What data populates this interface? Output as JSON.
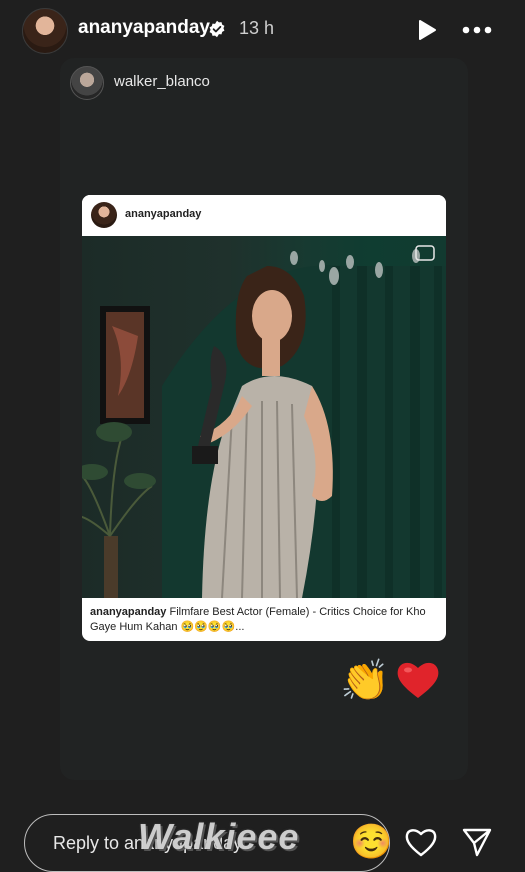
{
  "header": {
    "username": "ananyapanday",
    "time": "13 h",
    "icons": {
      "verified": "verified-badge-icon",
      "play": "play-icon",
      "more": "more-icon"
    }
  },
  "repost": {
    "username": "walker_blanco"
  },
  "post": {
    "username": "ananyapanday",
    "caption_user": "ananyapanday",
    "caption_text": "Filmfare Best Actor (Female) - Critics Choice for Kho Gaye Hum Kahan 🥹🥹🥹🥹..."
  },
  "reactions": {
    "clap": "👏",
    "heart_color": "#e0242b"
  },
  "reply": {
    "placeholder": "Reply to ananyapanday...",
    "watermark": "Walkieee",
    "emoji": "☺️"
  },
  "colors": {
    "background": "#1f1f1f",
    "card": "#212323",
    "accent_green": "#0f3d31"
  }
}
